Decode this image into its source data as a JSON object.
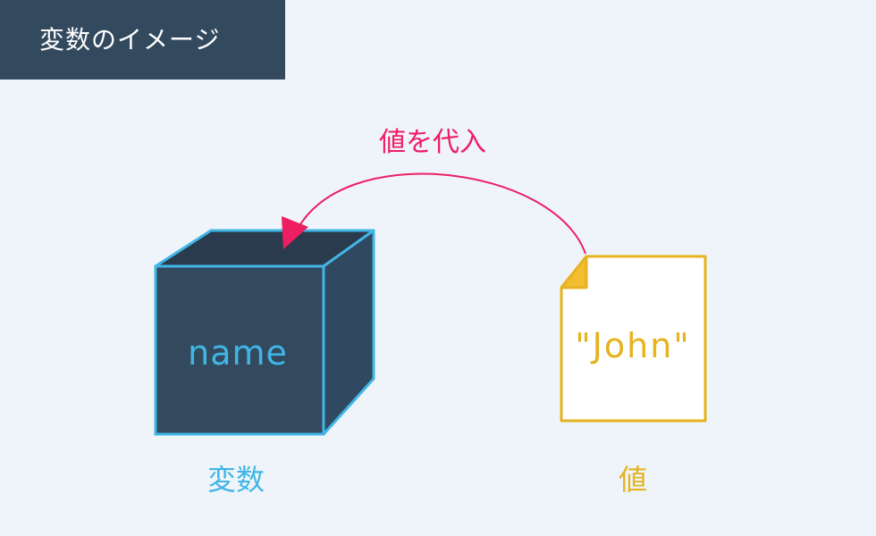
{
  "title": "変数のイメージ",
  "arrow_label": "値を代入",
  "variable_box": {
    "name_text": "name",
    "caption": "変数"
  },
  "value_doc": {
    "value_text": "\"John\"",
    "caption": "値"
  },
  "colors": {
    "badge_bg": "#334a5e",
    "background": "#eff4fb",
    "box_stroke": "#41b6e6",
    "box_front": "#334a5e",
    "box_top": "#293b4d",
    "box_side": "#304860",
    "arrow": "#ee1e63",
    "doc_stroke": "#e6b31e",
    "doc_corner": "#f2bd2e"
  }
}
